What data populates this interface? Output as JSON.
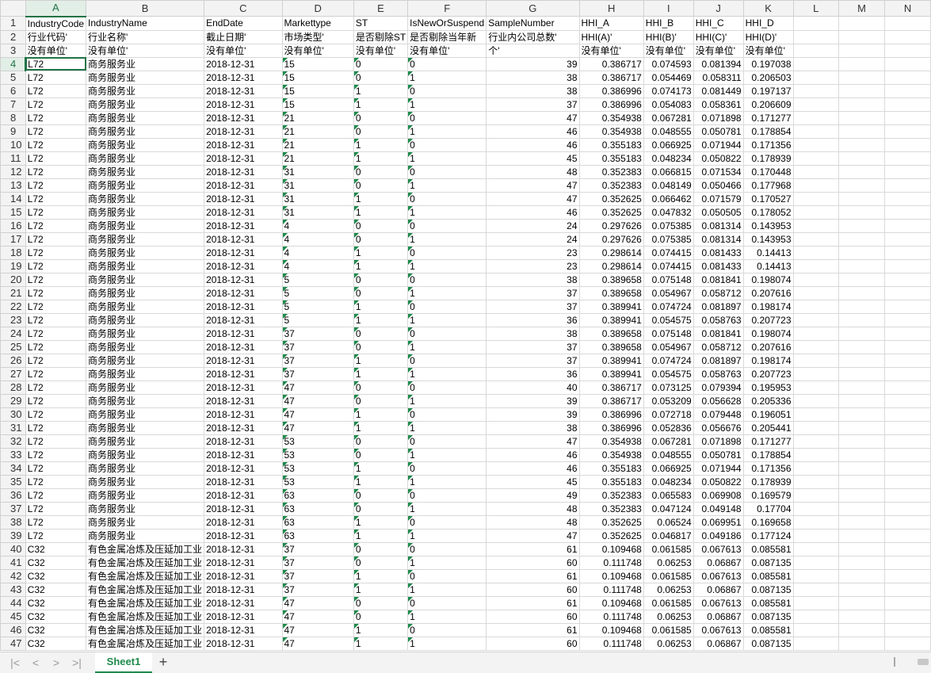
{
  "columns": [
    "A",
    "B",
    "C",
    "D",
    "E",
    "F",
    "G",
    "H",
    "I",
    "J",
    "K",
    "L",
    "M",
    "N"
  ],
  "selected_column": "A",
  "selected_row": 4,
  "active_cell": "A4",
  "header_rows": [
    [
      "IndustryCode",
      "IndustryName",
      "EndDate",
      "Markettype",
      "ST",
      "IsNewOrSuspend",
      "SampleNumber",
      "HHI_A",
      "HHI_B",
      "HHI_C",
      "HHI_D"
    ],
    [
      "行业代码'",
      "行业名称'",
      "截止日期'",
      "市场类型'",
      "是否剔除ST",
      "是否剔除当年新",
      "行业内公司总数'",
      "HHI(A)'",
      "HHI(B)'",
      "HHI(C)'",
      "HHI(D)'"
    ],
    [
      "没有单位'",
      "没有单位'",
      "没有单位'",
      "没有单位'",
      "没有单位'",
      "没有单位'",
      "个'",
      "没有单位'",
      "没有单位'",
      "没有单位'",
      "没有单位'"
    ]
  ],
  "data_rows": [
    [
      "L72",
      "商务服务业",
      "2018-12-31",
      "15",
      "0",
      "0",
      "39",
      "0.386717",
      "0.074593",
      "0.081394",
      "0.197038"
    ],
    [
      "L72",
      "商务服务业",
      "2018-12-31",
      "15",
      "0",
      "1",
      "38",
      "0.386717",
      "0.054469",
      "0.058311",
      "0.206503"
    ],
    [
      "L72",
      "商务服务业",
      "2018-12-31",
      "15",
      "1",
      "0",
      "38",
      "0.386996",
      "0.074173",
      "0.081449",
      "0.197137"
    ],
    [
      "L72",
      "商务服务业",
      "2018-12-31",
      "15",
      "1",
      "1",
      "37",
      "0.386996",
      "0.054083",
      "0.058361",
      "0.206609"
    ],
    [
      "L72",
      "商务服务业",
      "2018-12-31",
      "21",
      "0",
      "0",
      "47",
      "0.354938",
      "0.067281",
      "0.071898",
      "0.171277"
    ],
    [
      "L72",
      "商务服务业",
      "2018-12-31",
      "21",
      "0",
      "1",
      "46",
      "0.354938",
      "0.048555",
      "0.050781",
      "0.178854"
    ],
    [
      "L72",
      "商务服务业",
      "2018-12-31",
      "21",
      "1",
      "0",
      "46",
      "0.355183",
      "0.066925",
      "0.071944",
      "0.171356"
    ],
    [
      "L72",
      "商务服务业",
      "2018-12-31",
      "21",
      "1",
      "1",
      "45",
      "0.355183",
      "0.048234",
      "0.050822",
      "0.178939"
    ],
    [
      "L72",
      "商务服务业",
      "2018-12-31",
      "31",
      "0",
      "0",
      "48",
      "0.352383",
      "0.066815",
      "0.071534",
      "0.170448"
    ],
    [
      "L72",
      "商务服务业",
      "2018-12-31",
      "31",
      "0",
      "1",
      "47",
      "0.352383",
      "0.048149",
      "0.050466",
      "0.177968"
    ],
    [
      "L72",
      "商务服务业",
      "2018-12-31",
      "31",
      "1",
      "0",
      "47",
      "0.352625",
      "0.066462",
      "0.071579",
      "0.170527"
    ],
    [
      "L72",
      "商务服务业",
      "2018-12-31",
      "31",
      "1",
      "1",
      "46",
      "0.352625",
      "0.047832",
      "0.050505",
      "0.178052"
    ],
    [
      "L72",
      "商务服务业",
      "2018-12-31",
      "4",
      "0",
      "0",
      "24",
      "0.297626",
      "0.075385",
      "0.081314",
      "0.143953"
    ],
    [
      "L72",
      "商务服务业",
      "2018-12-31",
      "4",
      "0",
      "1",
      "24",
      "0.297626",
      "0.075385",
      "0.081314",
      "0.143953"
    ],
    [
      "L72",
      "商务服务业",
      "2018-12-31",
      "4",
      "1",
      "0",
      "23",
      "0.298614",
      "0.074415",
      "0.081433",
      "0.14413"
    ],
    [
      "L72",
      "商务服务业",
      "2018-12-31",
      "4",
      "1",
      "1",
      "23",
      "0.298614",
      "0.074415",
      "0.081433",
      "0.14413"
    ],
    [
      "L72",
      "商务服务业",
      "2018-12-31",
      "5",
      "0",
      "0",
      "38",
      "0.389658",
      "0.075148",
      "0.081841",
      "0.198074"
    ],
    [
      "L72",
      "商务服务业",
      "2018-12-31",
      "5",
      "0",
      "1",
      "37",
      "0.389658",
      "0.054967",
      "0.058712",
      "0.207616"
    ],
    [
      "L72",
      "商务服务业",
      "2018-12-31",
      "5",
      "1",
      "0",
      "37",
      "0.389941",
      "0.074724",
      "0.081897",
      "0.198174"
    ],
    [
      "L72",
      "商务服务业",
      "2018-12-31",
      "5",
      "1",
      "1",
      "36",
      "0.389941",
      "0.054575",
      "0.058763",
      "0.207723"
    ],
    [
      "L72",
      "商务服务业",
      "2018-12-31",
      "37",
      "0",
      "0",
      "38",
      "0.389658",
      "0.075148",
      "0.081841",
      "0.198074"
    ],
    [
      "L72",
      "商务服务业",
      "2018-12-31",
      "37",
      "0",
      "1",
      "37",
      "0.389658",
      "0.054967",
      "0.058712",
      "0.207616"
    ],
    [
      "L72",
      "商务服务业",
      "2018-12-31",
      "37",
      "1",
      "0",
      "37",
      "0.389941",
      "0.074724",
      "0.081897",
      "0.198174"
    ],
    [
      "L72",
      "商务服务业",
      "2018-12-31",
      "37",
      "1",
      "1",
      "36",
      "0.389941",
      "0.054575",
      "0.058763",
      "0.207723"
    ],
    [
      "L72",
      "商务服务业",
      "2018-12-31",
      "47",
      "0",
      "0",
      "40",
      "0.386717",
      "0.073125",
      "0.079394",
      "0.195953"
    ],
    [
      "L72",
      "商务服务业",
      "2018-12-31",
      "47",
      "0",
      "1",
      "39",
      "0.386717",
      "0.053209",
      "0.056628",
      "0.205336"
    ],
    [
      "L72",
      "商务服务业",
      "2018-12-31",
      "47",
      "1",
      "0",
      "39",
      "0.386996",
      "0.072718",
      "0.079448",
      "0.196051"
    ],
    [
      "L72",
      "商务服务业",
      "2018-12-31",
      "47",
      "1",
      "1",
      "38",
      "0.386996",
      "0.052836",
      "0.056676",
      "0.205441"
    ],
    [
      "L72",
      "商务服务业",
      "2018-12-31",
      "53",
      "0",
      "0",
      "47",
      "0.354938",
      "0.067281",
      "0.071898",
      "0.171277"
    ],
    [
      "L72",
      "商务服务业",
      "2018-12-31",
      "53",
      "0",
      "1",
      "46",
      "0.354938",
      "0.048555",
      "0.050781",
      "0.178854"
    ],
    [
      "L72",
      "商务服务业",
      "2018-12-31",
      "53",
      "1",
      "0",
      "46",
      "0.355183",
      "0.066925",
      "0.071944",
      "0.171356"
    ],
    [
      "L72",
      "商务服务业",
      "2018-12-31",
      "53",
      "1",
      "1",
      "45",
      "0.355183",
      "0.048234",
      "0.050822",
      "0.178939"
    ],
    [
      "L72",
      "商务服务业",
      "2018-12-31",
      "63",
      "0",
      "0",
      "49",
      "0.352383",
      "0.065583",
      "0.069908",
      "0.169579"
    ],
    [
      "L72",
      "商务服务业",
      "2018-12-31",
      "63",
      "0",
      "1",
      "48",
      "0.352383",
      "0.047124",
      "0.049148",
      "0.17704"
    ],
    [
      "L72",
      "商务服务业",
      "2018-12-31",
      "63",
      "1",
      "0",
      "48",
      "0.352625",
      "0.06524",
      "0.069951",
      "0.169658"
    ],
    [
      "L72",
      "商务服务业",
      "2018-12-31",
      "63",
      "1",
      "1",
      "47",
      "0.352625",
      "0.046817",
      "0.049186",
      "0.177124"
    ],
    [
      "C32",
      "有色金属冶炼及压延加工业",
      "2018-12-31",
      "37",
      "0",
      "0",
      "61",
      "0.109468",
      "0.061585",
      "0.067613",
      "0.085581"
    ],
    [
      "C32",
      "有色金属冶炼及压延加工业",
      "2018-12-31",
      "37",
      "0",
      "1",
      "60",
      "0.111748",
      "0.06253",
      "0.06867",
      "0.087135"
    ],
    [
      "C32",
      "有色金属冶炼及压延加工业",
      "2018-12-31",
      "37",
      "1",
      "0",
      "61",
      "0.109468",
      "0.061585",
      "0.067613",
      "0.085581"
    ],
    [
      "C32",
      "有色金属冶炼及压延加工业",
      "2018-12-31",
      "37",
      "1",
      "1",
      "60",
      "0.111748",
      "0.06253",
      "0.06867",
      "0.087135"
    ],
    [
      "C32",
      "有色金属冶炼及压延加工业",
      "2018-12-31",
      "47",
      "0",
      "0",
      "61",
      "0.109468",
      "0.061585",
      "0.067613",
      "0.085581"
    ],
    [
      "C32",
      "有色金属冶炼及压延加工业",
      "2018-12-31",
      "47",
      "0",
      "1",
      "60",
      "0.111748",
      "0.06253",
      "0.06867",
      "0.087135"
    ],
    [
      "C32",
      "有色金属冶炼及压延加工业",
      "2018-12-31",
      "47",
      "1",
      "0",
      "61",
      "0.109468",
      "0.061585",
      "0.067613",
      "0.085581"
    ],
    [
      "C32",
      "有色金属冶炼及压延加工业",
      "2018-12-31",
      "47",
      "1",
      "1",
      "60",
      "0.111748",
      "0.06253",
      "0.06867",
      "0.087135"
    ]
  ],
  "sheet_tabs": [
    "Sheet1"
  ],
  "add_sheet_label": "+",
  "nav_buttons": [
    "|<",
    "<",
    ">",
    ">|"
  ],
  "colors": {
    "accent": "#217346",
    "tab_text": "#1e8a4c",
    "triangle": "#1e8a4c"
  }
}
